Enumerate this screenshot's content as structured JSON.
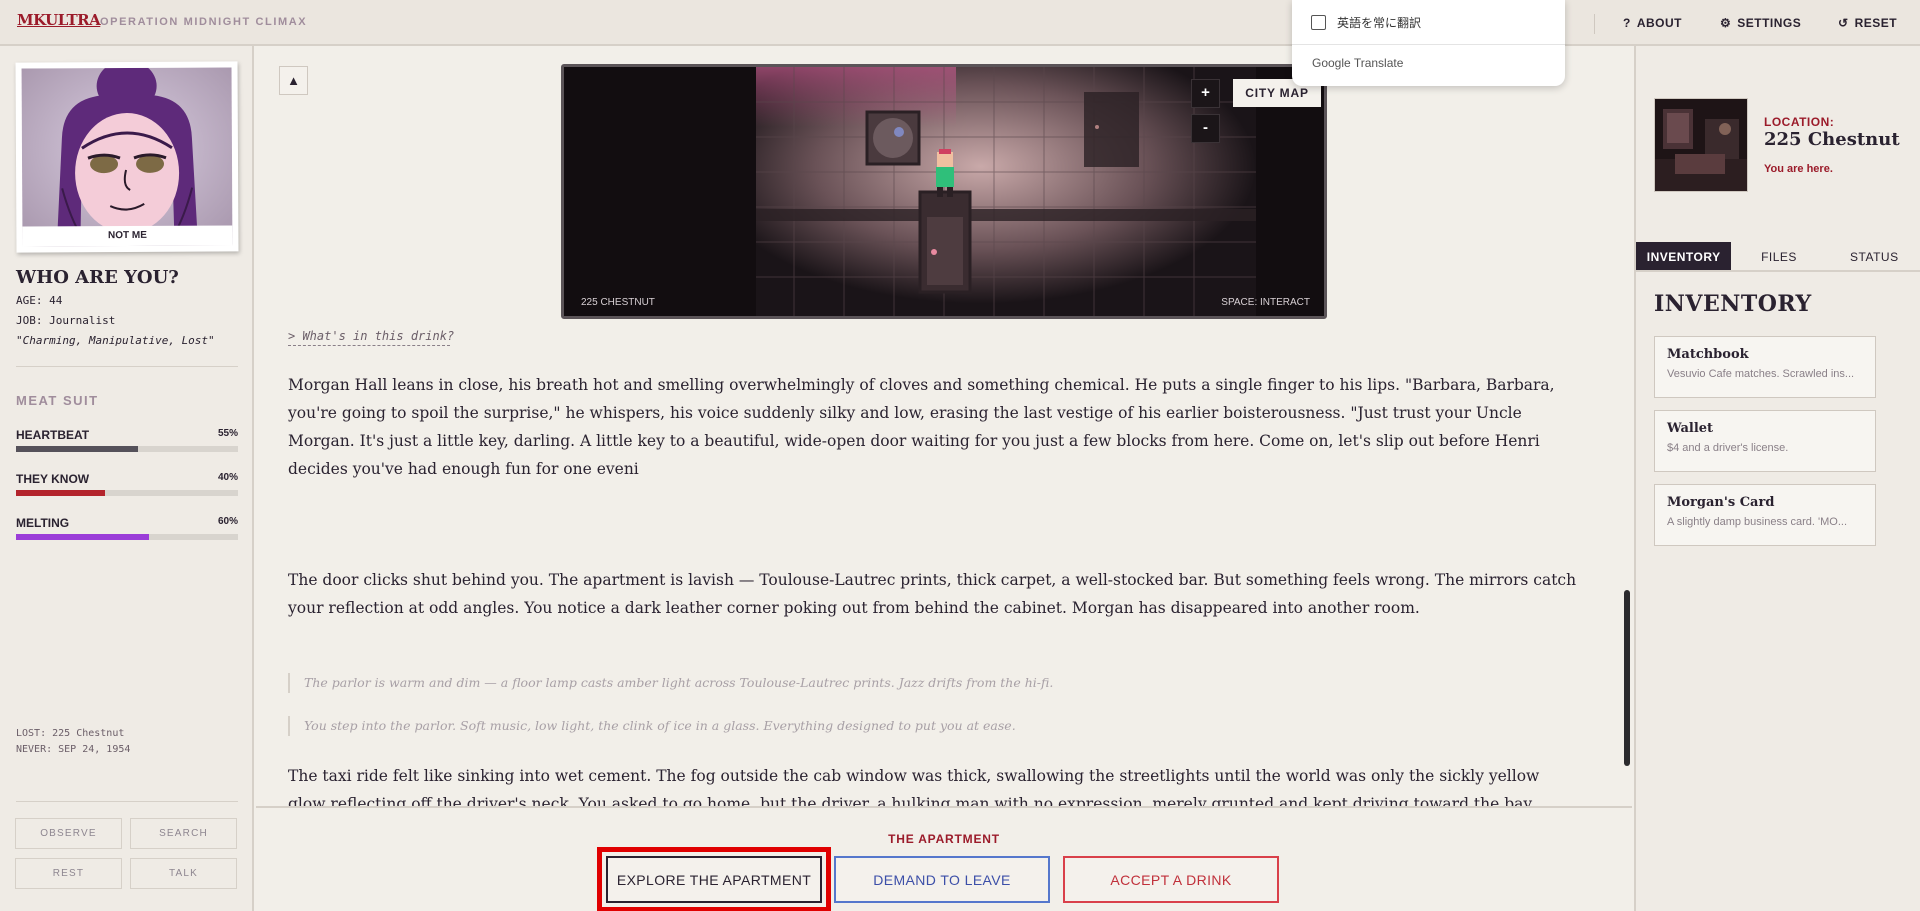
{
  "header": {
    "brand": "MKULTRA",
    "subtitle": "OPERATION MIDNIGHT CLIMAX",
    "about": "ABOUT",
    "settings": "SETTINGS",
    "reset": "RESET"
  },
  "translate_popup": {
    "option": "英語を常に翻訳",
    "brand": "Google Translate"
  },
  "character": {
    "portrait_caption": "NOT ME",
    "title": "WHO ARE YOU?",
    "age": "AGE: 44",
    "job": "JOB: Journalist",
    "quote": "\"Charming, Manipulative, Lost\""
  },
  "meat_suit": {
    "title": "MEAT SUIT",
    "stats": [
      {
        "label": "HEARTBEAT",
        "pct_text": "55%",
        "value": 55,
        "color": "#55515a"
      },
      {
        "label": "THEY KNOW",
        "pct_text": "40%",
        "value": 40,
        "color": "#b3242c"
      },
      {
        "label": "MELTING",
        "pct_text": "60%",
        "value": 60,
        "color": "#9b3dd8"
      }
    ]
  },
  "status_lines": {
    "lost": "LOST: 225 Chestnut",
    "never": "NEVER: SEP 24, 1954"
  },
  "actions": {
    "observe": "OBSERVE",
    "search": "SEARCH",
    "rest": "REST",
    "talk": "TALK"
  },
  "map": {
    "zoom_in": "+",
    "zoom_out": "-",
    "city_map": "CITY MAP",
    "location_tag": "225 CHESTNUT",
    "hint": "SPACE: INTERACT"
  },
  "story": {
    "prompt": "> What's in this drink?",
    "p1": "Morgan Hall leans in close, his breath hot and smelling overwhelmingly of cloves and something chemical. He puts a single finger to his lips. \"Barbara, Barbara, you're going to spoil the surprise,\" he whispers, his voice suddenly silky and low, erasing the last vestige of his earlier boisterousness. \"Just trust your Uncle Morgan. It's just a little key, darling. A little key to a beautiful, wide-open door waiting for you just a few blocks from here. Come on, let's slip out before Henri decides you've had enough fun for one eveni",
    "p2": "The door clicks shut behind you. The apartment is lavish — Toulouse-Lautrec prints, thick carpet, a well-stocked bar. But something feels wrong. The mirrors catch your reflection at odd angles. You notice a dark leather corner poking out from behind the cabinet. Morgan has disappeared into another room.",
    "q1": "The parlor is warm and dim — a floor lamp casts amber light across Toulouse-Lautrec prints. Jazz drifts from the hi-fi.",
    "q2": "You step into the parlor. Soft music, low light, the clink of ice in a glass. Everything designed to put you at ease.",
    "p3": "The taxi ride felt like sinking into wet cement. The fog outside the cab window was thick, swallowing the streetlights until the world was only the sickly yellow glow reflecting off the driver's neck. You asked to go home, but the driver, a hulking man with no expression, merely grunted and kept driving toward the bay. When the cab finally stopped, it was in front of a narrow, unlit building on Chestnut Street."
  },
  "scene": {
    "label": "THE APARTMENT",
    "choices": [
      "EXPLORE THE APARTMENT",
      "DEMAND TO LEAVE",
      "ACCEPT A DRINK"
    ]
  },
  "location": {
    "label": "LOCATION:",
    "name": "225 Chestnut",
    "sub": "You are here."
  },
  "tabs": [
    "INVENTORY",
    "FILES",
    "STATUS"
  ],
  "inventory": {
    "title": "INVENTORY",
    "items": [
      {
        "name": "Matchbook",
        "desc": "Vesuvio Cafe matches. Scrawled ins..."
      },
      {
        "name": "Wallet",
        "desc": "$4 and a driver's license."
      },
      {
        "name": "Morgan's Card",
        "desc": "A slightly damp business card. 'MO..."
      }
    ]
  },
  "colors": {
    "accent": "#9b1b2a",
    "ink": "#2a2230",
    "paper": "#f2efe9"
  }
}
